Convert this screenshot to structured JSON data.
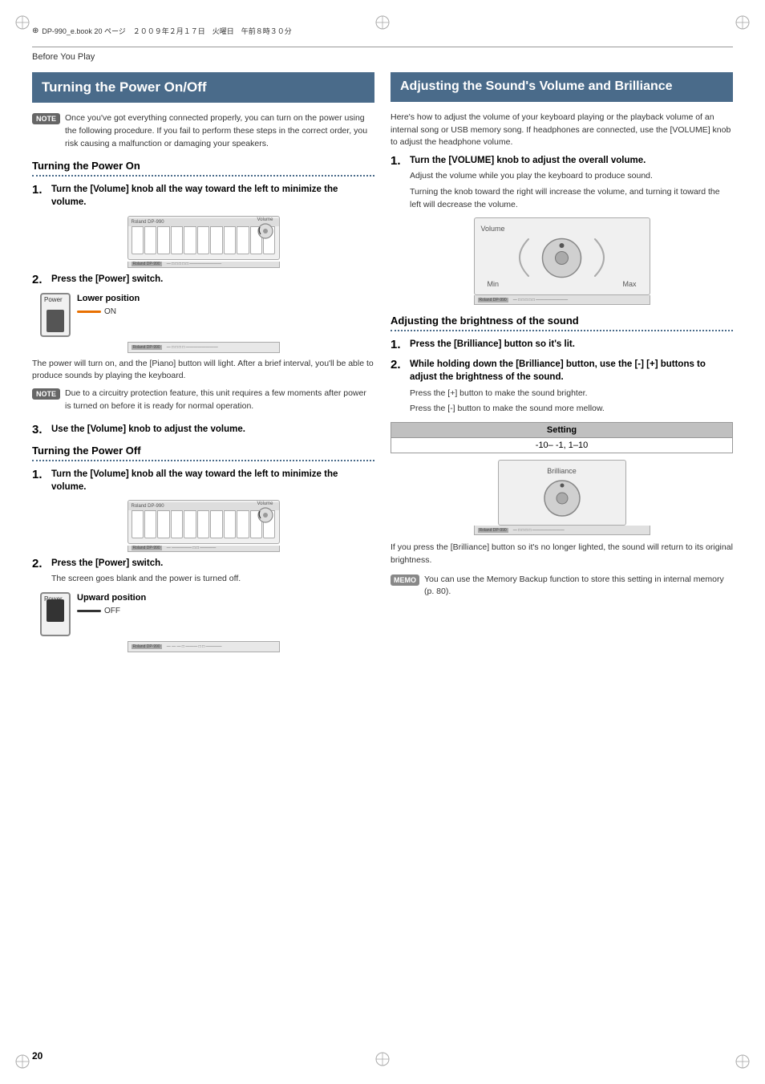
{
  "header": {
    "text": "DP-990_e.book 20 ページ　２００９年２月１７日　火曜日　午前８時３０分"
  },
  "breadcrumb": "Before You Play",
  "page_number": "20",
  "left": {
    "section_title": "Turning the Power On/Off",
    "note1": {
      "label": "NOTE",
      "text": "Once you've got everything connected properly, you can turn on the power using the following procedure. If you fail to perform these steps in the correct order, you risk causing a malfunction or damaging your speakers."
    },
    "subsection1": {
      "heading": "Turning the Power On",
      "step1": {
        "number": "1.",
        "text": "Turn the [Volume] knob all the way toward the left to minimize the volume."
      },
      "step2": {
        "number": "2.",
        "text": "Press the [Power] switch.",
        "lower_position": "Lower position",
        "on_label": "ON",
        "power_label": "Power"
      },
      "body1": "The power will turn on, and the [Piano] button will light. After a brief interval, you'll be able to produce sounds by playing the keyboard.",
      "note2": {
        "label": "NOTE",
        "text": "Due to a circuitry protection feature, this unit requires a few moments after power is turned on before it is ready for normal operation."
      },
      "step3": {
        "number": "3.",
        "text": "Use the [Volume] knob to adjust the volume."
      }
    },
    "subsection2": {
      "heading": "Turning the Power Off",
      "step1": {
        "number": "1.",
        "text": "Turn the [Volume] knob all the way toward the left to minimize the volume."
      },
      "step2": {
        "number": "2.",
        "text": "Press the [Power] switch.",
        "body": "The screen goes blank and the power is turned off.",
        "upward_position": "Upward position",
        "off_label": "OFF",
        "power_label": "Power"
      }
    }
  },
  "right": {
    "section_title": "Adjusting the Sound's Volume and Brilliance",
    "intro": "Here's how to adjust the volume of your keyboard playing or the playback volume of an internal song or USB memory song. If headphones are connected, use the [VOLUME] knob to adjust the headphone volume.",
    "step1": {
      "number": "1.",
      "text": "Turn the [VOLUME] knob to adjust the overall volume.",
      "body1": "Adjust the volume while you play the keyboard to produce sound.",
      "body2": "Turning the knob toward the right will increase the volume, and turning it toward the left will decrease the volume.",
      "volume_label": "Volume",
      "min_label": "Min",
      "max_label": "Max"
    },
    "subsection_brightness": {
      "heading": "Adjusting the brightness of the sound",
      "step1": {
        "number": "1.",
        "text": "Press the [Brilliance] button so it's lit."
      },
      "step2": {
        "number": "2.",
        "text": "While holding down the [Brilliance] button, use the [-] [+] buttons to adjust the brightness of the sound.",
        "body1": "Press the [+] button to make the sound brighter.",
        "body2": "Press the [-] button to make the sound more mellow.",
        "table_header": "Setting",
        "table_value": "-10– -1, 1–10",
        "brilliance_label": "Brilliance"
      },
      "body_after": "If you press the [Brilliance] button so it's no longer lighted, the sound will return to its original brightness.",
      "memo": {
        "label": "MEMO",
        "text": "You can use the Memory Backup function to store this setting in internal memory (p. 80)."
      }
    }
  }
}
